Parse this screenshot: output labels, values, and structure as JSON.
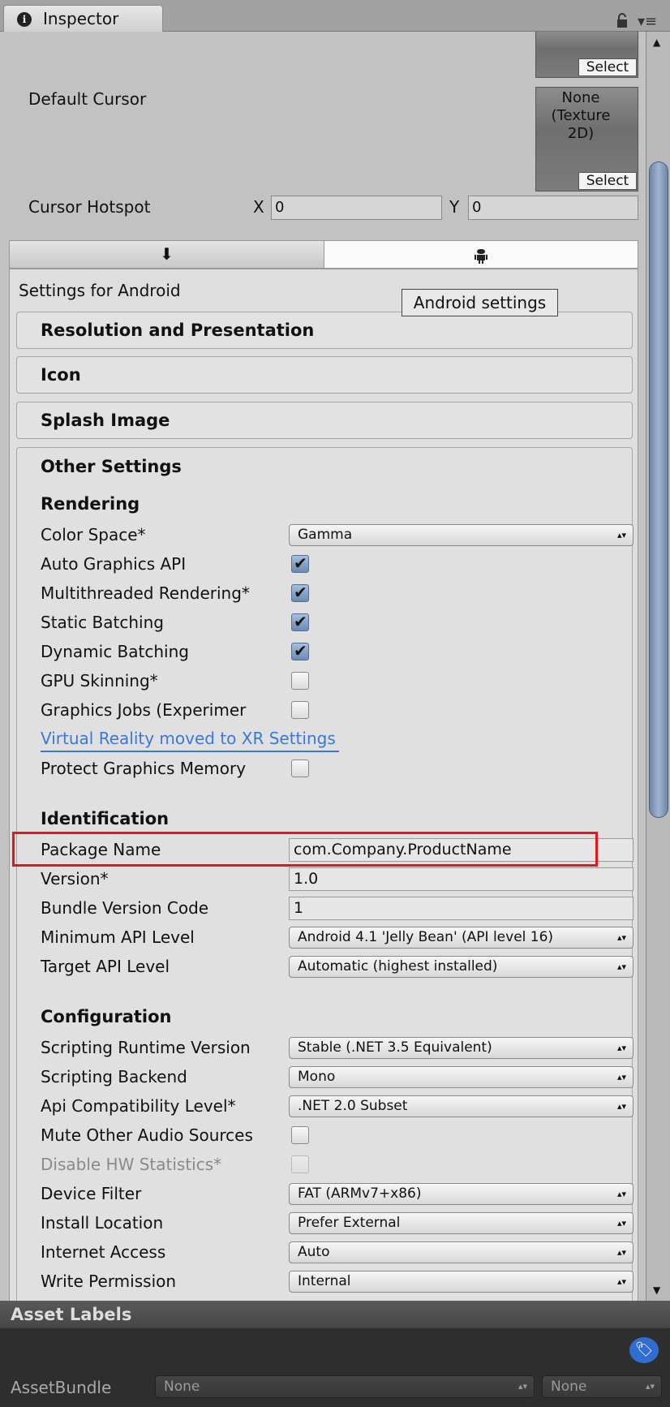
{
  "window": {
    "tab_title": "Inspector",
    "icons": [
      "info-icon",
      "lock-icon",
      "menu-icon"
    ]
  },
  "cursor": {
    "default_cursor_label": "Default Cursor",
    "select_label": "Select",
    "texture_none": "None (Texture 2D)",
    "hotspot_label": "Cursor Hotspot",
    "x_label": "X",
    "x_value": "0",
    "y_label": "Y",
    "y_value": "0"
  },
  "platform": {
    "tabs": [
      {
        "icon": "download-icon",
        "glyph": "⬇",
        "selected": false
      },
      {
        "icon": "android-icon",
        "glyph": "🤖",
        "selected": true
      }
    ],
    "settings_for": "Settings for Android",
    "tooltip": "Android settings"
  },
  "headers": [
    "Resolution and Presentation",
    "Icon",
    "Splash Image",
    "Other Settings"
  ],
  "sections": [
    {
      "title": "Rendering",
      "rows": [
        {
          "label": "Color Space*",
          "type": "dropdown",
          "value": "Gamma"
        },
        {
          "label": "Auto Graphics API",
          "type": "checkbox",
          "checked": true
        },
        {
          "label": "Multithreaded Rendering*",
          "type": "checkbox",
          "checked": true
        },
        {
          "label": "Static Batching",
          "type": "checkbox",
          "checked": true
        },
        {
          "label": "Dynamic Batching",
          "type": "checkbox",
          "checked": true
        },
        {
          "label": "GPU Skinning*",
          "type": "checkbox",
          "checked": false
        },
        {
          "label": "Graphics Jobs (Experimer",
          "type": "checkbox",
          "checked": false
        },
        {
          "label": "Virtual Reality moved to XR Settings",
          "type": "link"
        },
        {
          "label": "Protect Graphics Memory",
          "type": "checkbox",
          "checked": false
        }
      ]
    },
    {
      "title": "Identification",
      "rows": [
        {
          "label": "Package Name",
          "type": "text",
          "value": "com.Company.ProductName",
          "highlighted": true
        },
        {
          "label": "Version*",
          "type": "text",
          "value": "1.0"
        },
        {
          "label": "Bundle Version Code",
          "type": "text",
          "value": "1"
        },
        {
          "label": "Minimum API Level",
          "type": "dropdown",
          "value": "Android 4.1 'Jelly Bean' (API level 16)"
        },
        {
          "label": "Target API Level",
          "type": "dropdown",
          "value": "Automatic (highest installed)"
        }
      ]
    },
    {
      "title": "Configuration",
      "rows": [
        {
          "label": "Scripting Runtime Version",
          "type": "dropdown",
          "value": "Stable (.NET 3.5 Equivalent)"
        },
        {
          "label": "Scripting Backend",
          "type": "dropdown",
          "value": "Mono"
        },
        {
          "label": "Api Compatibility Level*",
          "type": "dropdown",
          "value": ".NET 2.0 Subset"
        },
        {
          "label": "Mute Other Audio Sources",
          "type": "checkbox",
          "checked": false
        },
        {
          "label": "Disable HW Statistics*",
          "type": "checkbox",
          "checked": false,
          "disabled": true
        },
        {
          "label": "Device Filter",
          "type": "dropdown",
          "value": "FAT (ARMv7+x86)"
        },
        {
          "label": "Install Location",
          "type": "dropdown",
          "value": "Prefer External"
        },
        {
          "label": "Internet Access",
          "type": "dropdown",
          "value": "Auto"
        },
        {
          "label": "Write Permission",
          "type": "dropdown",
          "value": "Internal"
        }
      ]
    }
  ],
  "asset_labels": {
    "title": "Asset Labels",
    "tag_icon": "tag-icon",
    "bundle_label": "AssetBundle",
    "bundle_value": "None",
    "variant_value": "None"
  },
  "colors": {
    "highlight": "#e3161b",
    "link": "#3a78d6",
    "tag": "#2f6ed0"
  }
}
